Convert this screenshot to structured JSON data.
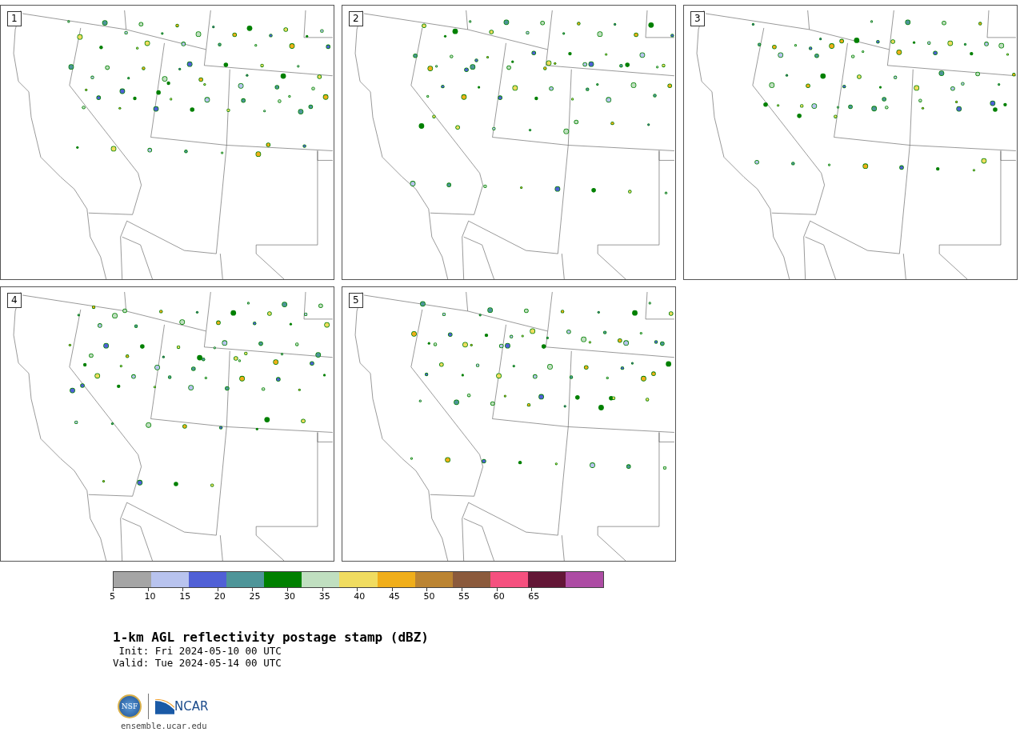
{
  "panels": [
    {
      "label": "1"
    },
    {
      "label": "2"
    },
    {
      "label": "3"
    },
    {
      "label": "4"
    },
    {
      "label": "5"
    }
  ],
  "colorbar": {
    "segments": [
      {
        "color": "#a5a5a5"
      },
      {
        "color": "#b8c3ee"
      },
      {
        "color": "#5060d6"
      },
      {
        "color": "#4e9599"
      },
      {
        "color": "#008000"
      },
      {
        "color": "#c0dfc0"
      },
      {
        "color": "#f0dc60"
      },
      {
        "color": "#f0ae1a"
      },
      {
        "color": "#bb8432"
      },
      {
        "color": "#8b5a3c"
      },
      {
        "color": "#f5507f"
      },
      {
        "color": "#631636"
      },
      {
        "color": "#ad4ca4"
      }
    ],
    "ticks": [
      "5",
      "10",
      "15",
      "20",
      "25",
      "30",
      "35",
      "40",
      "45",
      "50",
      "55",
      "60",
      "65"
    ]
  },
  "title": "1-km AGL reflectivity postage stamp (dBZ)",
  "init": " Init: Fri 2024-05-10 00 UTC",
  "valid": "Valid: Tue 2024-05-14 00 UTC",
  "logo": {
    "nsf": "NSF",
    "ncar": "NCAR"
  },
  "site": "ensemble.ucar.edu"
}
